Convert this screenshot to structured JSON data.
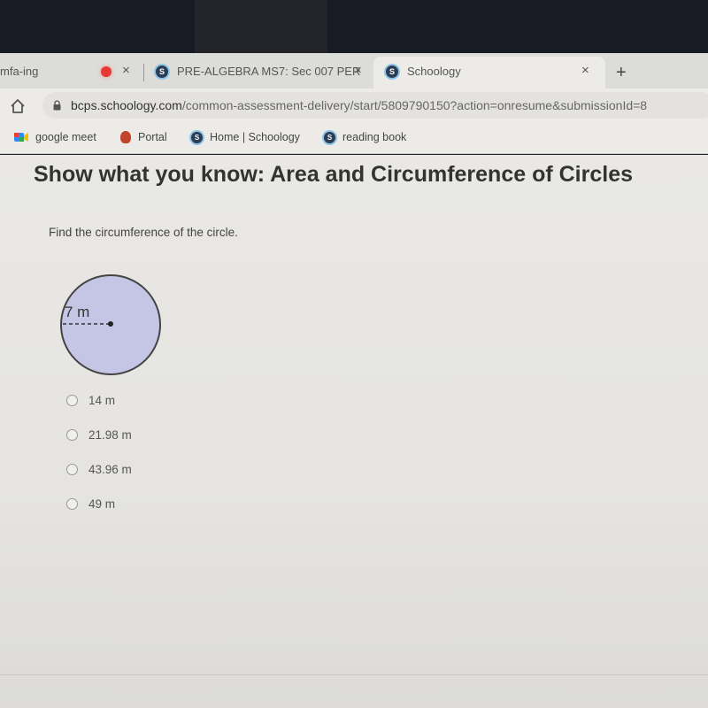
{
  "browser": {
    "tabs": [
      {
        "label": "mfa-ing",
        "recording": true,
        "close": "×"
      },
      {
        "label": "PRE-ALGEBRA MS7: Sec 007 PER",
        "icon": "schoology-icon",
        "close": "×"
      },
      {
        "label": "Schoology",
        "icon": "schoology-icon",
        "active": true,
        "close": "×"
      }
    ],
    "new_tab": "+",
    "url": {
      "host": "bcps.schoology.com",
      "path": "/common-assessment-delivery/start/5809790150?action=onresume&submissionId=8"
    },
    "bookmarks": [
      {
        "label": "google meet",
        "icon": "google-meet-icon"
      },
      {
        "label": "Portal",
        "icon": "portal-icon"
      },
      {
        "label": "Home | Schoology",
        "icon": "schoology-icon"
      },
      {
        "label": "reading book",
        "icon": "schoology-icon"
      }
    ]
  },
  "page": {
    "title": "Show what you know: Area and Circumference of Circles",
    "question": "Find the circumference of the circle.",
    "figure": {
      "radius_label": "7 m",
      "fill_color": "#c5c5e6",
      "stroke_color": "#444444"
    },
    "options": [
      {
        "label": "14 m",
        "selected": false
      },
      {
        "label": "21.98 m",
        "selected": false
      },
      {
        "label": "43.96 m",
        "selected": false
      },
      {
        "label": "49 m",
        "selected": false
      }
    ]
  }
}
